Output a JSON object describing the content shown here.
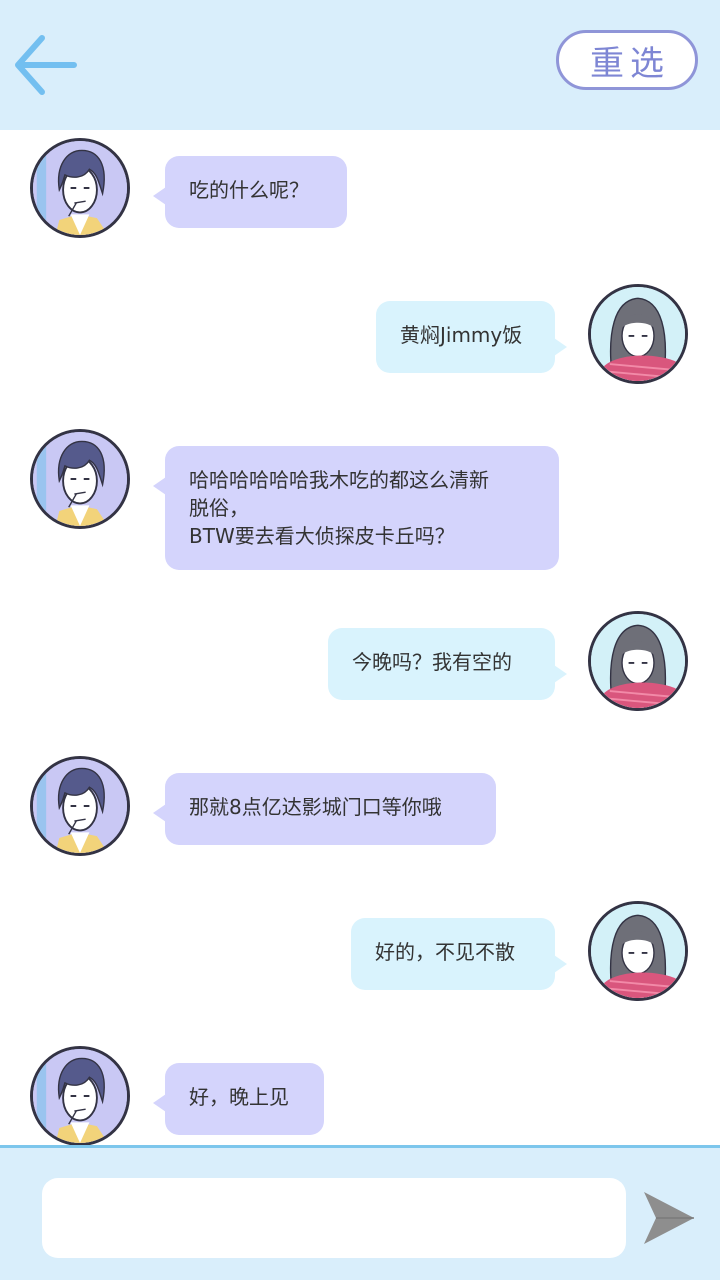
{
  "header": {
    "back_icon": "arrow-left-icon",
    "reselect_label": "重选",
    "accent_color": "#73bff0",
    "background": "#d9eefb"
  },
  "messages": [
    {
      "side": "left",
      "sender": "boy",
      "text": "吃的什么呢？"
    },
    {
      "side": "right",
      "sender": "girl",
      "text": "黄焖Jimmy饭"
    },
    {
      "side": "left",
      "sender": "boy",
      "text": "哈哈哈哈哈哈我木吃的都这么清新\n脱俗，\nBTW要去看大侦探皮卡丘吗？"
    },
    {
      "side": "right",
      "sender": "girl",
      "text": "今晚吗？我有空的"
    },
    {
      "side": "left",
      "sender": "boy",
      "text": "那就8点亿达影城门口等你哦"
    },
    {
      "side": "right",
      "sender": "girl",
      "text": "好的，不见不散"
    },
    {
      "side": "left",
      "sender": "boy",
      "text": "好，晚上见"
    }
  ],
  "composer": {
    "value": "",
    "placeholder": "",
    "send_icon": "send-arrow-icon"
  },
  "colors": {
    "left_bubble": "#d4d4fc",
    "right_bubble": "#d9f3fd",
    "footer_divider": "#7cc6ec"
  }
}
